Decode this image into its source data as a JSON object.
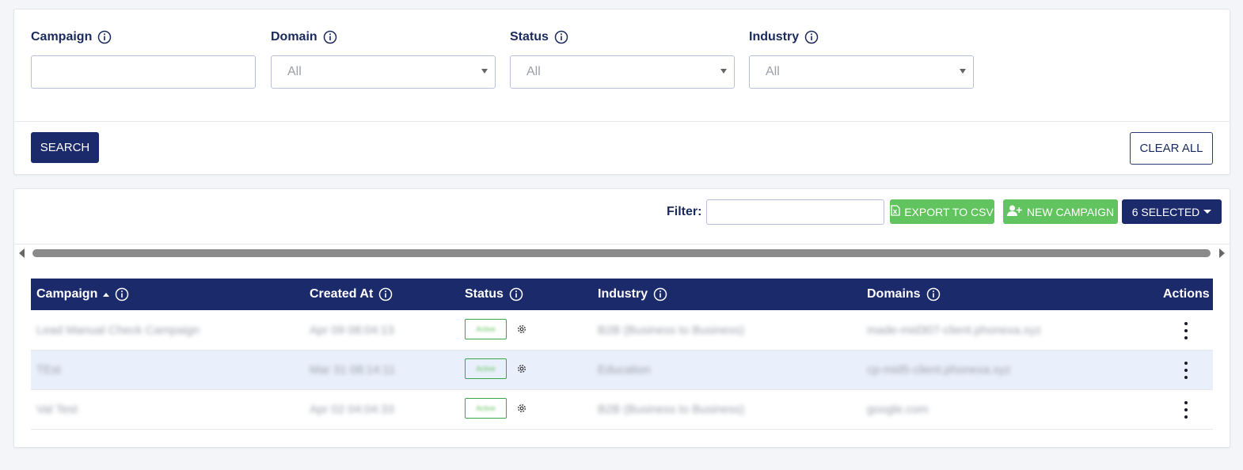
{
  "search_panel": {
    "fields": [
      {
        "label": "Campaign",
        "value": "",
        "placeholder": ""
      },
      {
        "label": "Domain",
        "value": "All"
      },
      {
        "label": "Status",
        "value": "All"
      },
      {
        "label": "Industry",
        "value": "All"
      }
    ],
    "search_label": "SEARCH",
    "clear_label": "CLEAR ALL"
  },
  "toolbar": {
    "filter_label": "Filter:",
    "filter_value": "",
    "export_label": "EXPORT TO CSV",
    "new_campaign_label": "NEW CAMPAIGN",
    "selected_label": "6 SELECTED"
  },
  "table": {
    "columns": [
      "Campaign",
      "Created At",
      "Status",
      "Industry",
      "Domains",
      "Actions"
    ],
    "sort_column": "Campaign",
    "sort_direction": "ascending",
    "rows": [
      {
        "campaign": "Lead Manual Check Campaign",
        "created_at": "Apr 09 08:04:13",
        "status": "Active",
        "industry": "B2B (Business to Business)",
        "domains": "made-mid307-client.phonexa.xyz"
      },
      {
        "campaign": "TEst",
        "created_at": "Mar 31 08:14:11",
        "status": "Active",
        "industry": "Education",
        "domains": "cp-mid5-client.phonexa.xyz"
      },
      {
        "campaign": "Val Test",
        "created_at": "Apr 02 04:04:33",
        "status": "Active",
        "industry": "B2B (Business to Business)",
        "domains": "google.com"
      }
    ]
  },
  "colors": {
    "primary": "#1b2a6b",
    "success": "#62c45e",
    "row_highlight": "#eaf0fb",
    "page_bg": "#f3f5f9"
  }
}
